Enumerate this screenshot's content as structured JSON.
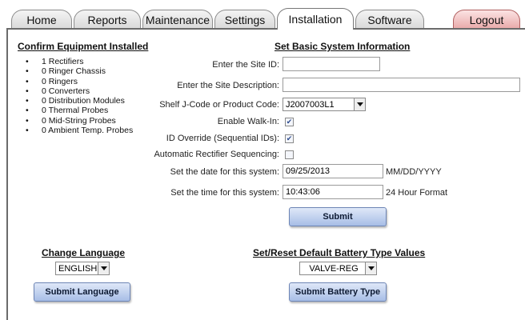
{
  "tabs": [
    {
      "label": "Home"
    },
    {
      "label": "Reports"
    },
    {
      "label": "Maintenance"
    },
    {
      "label": "Settings"
    },
    {
      "label": "Installation"
    },
    {
      "label": "Software"
    },
    {
      "label": "Logout"
    }
  ],
  "active_tab": "Installation",
  "equipment": {
    "title": "Confirm Equipment Installed",
    "items": [
      "1 Rectifiers",
      "0 Ringer Chassis",
      "0 Ringers",
      "0 Converters",
      "0 Distribution Modules",
      "0 Thermal Probes",
      "0 Mid-String Probes",
      "0 Ambient Temp. Probes"
    ]
  },
  "system_info": {
    "title": "Set Basic System Information",
    "site_id_label": "Enter the Site ID:",
    "site_id_value": "",
    "site_desc_label": "Enter the Site Description:",
    "site_desc_value": "",
    "shelf_label": "Shelf J-Code or Product Code:",
    "shelf_value": "J2007003L1",
    "walkin_label": "Enable Walk-In:",
    "walkin_checked": true,
    "idoverride_label": "ID Override (Sequential IDs):",
    "idoverride_checked": true,
    "autoseq_label": "Automatic Rectifier Sequencing:",
    "autoseq_checked": false,
    "date_label": "Set the date for this system:",
    "date_value": "09/25/2013",
    "date_format": "MM/DD/YYYY",
    "time_label": "Set the time for this system:",
    "time_value": "10:43:06",
    "time_format": "24 Hour Format",
    "submit_label": "Submit"
  },
  "language": {
    "title": "Change Language",
    "value": "ENGLISH",
    "submit_label": "Submit Language"
  },
  "battery": {
    "title": "Set/Reset Default Battery Type Values",
    "value": "VALVE-REG",
    "submit_label": "Submit Battery Type"
  },
  "colors": {
    "logout_tab": "#e9a9a9",
    "button": "#a7bde6",
    "panel_border": "#6b6b6b"
  }
}
